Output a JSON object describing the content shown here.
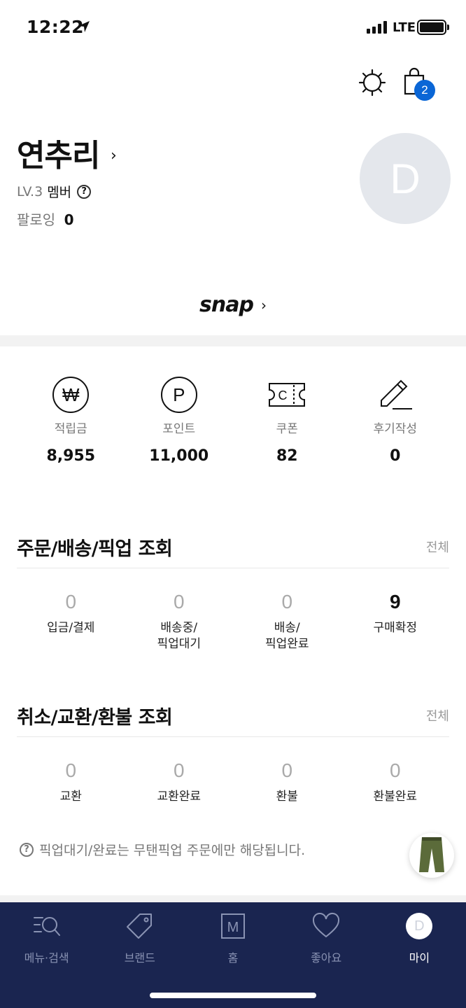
{
  "status_bar": {
    "time": "12:22",
    "network": "LTE"
  },
  "header": {
    "cart_count": "2"
  },
  "profile": {
    "name": "연추리",
    "level": "LV.3",
    "member_label": "멤버",
    "following_label": "팔로잉",
    "following_count": "0",
    "avatar_initial": "D"
  },
  "snap": {
    "label": "snap"
  },
  "benefits": [
    {
      "icon": "won-icon",
      "label": "적립금",
      "value": "8,955"
    },
    {
      "icon": "point-icon",
      "label": "포인트",
      "value": "11,000"
    },
    {
      "icon": "coupon-icon",
      "label": "쿠폰",
      "value": "82"
    },
    {
      "icon": "review-pen-icon",
      "label": "후기작성",
      "value": "0"
    }
  ],
  "orders": {
    "title": "주문/배송/픽업 조회",
    "all_label": "전체",
    "items": [
      {
        "count": "0",
        "label": "입금/결제"
      },
      {
        "count": "0",
        "label": "배송중/\n픽업대기"
      },
      {
        "count": "0",
        "label": "배송/\n픽업완료"
      },
      {
        "count": "9",
        "label": "구매확정"
      }
    ]
  },
  "returns": {
    "title": "취소/교환/환불 조회",
    "all_label": "전체",
    "items": [
      {
        "count": "0",
        "label": "교환"
      },
      {
        "count": "0",
        "label": "교환완료"
      },
      {
        "count": "0",
        "label": "환불"
      },
      {
        "count": "0",
        "label": "환불완료"
      }
    ]
  },
  "note": "픽업대기/완료는 무탠픽업 주문에만 해당됩니다.",
  "tab_bar": {
    "tabs": [
      {
        "icon": "menu-search-icon",
        "label": "메뉴·검색"
      },
      {
        "icon": "tag-icon",
        "label": "브랜드"
      },
      {
        "icon": "home-m-icon",
        "label": "홈"
      },
      {
        "icon": "heart-icon",
        "label": "좋아요"
      },
      {
        "icon": "avatar-icon",
        "label": "마이",
        "avatar_initial": "D"
      }
    ],
    "active_tab": "마이"
  },
  "colors": {
    "accent": "#0a66d6",
    "tab_bar_bg": "#1a2550",
    "avatar_bg": "#e4e7ec"
  }
}
